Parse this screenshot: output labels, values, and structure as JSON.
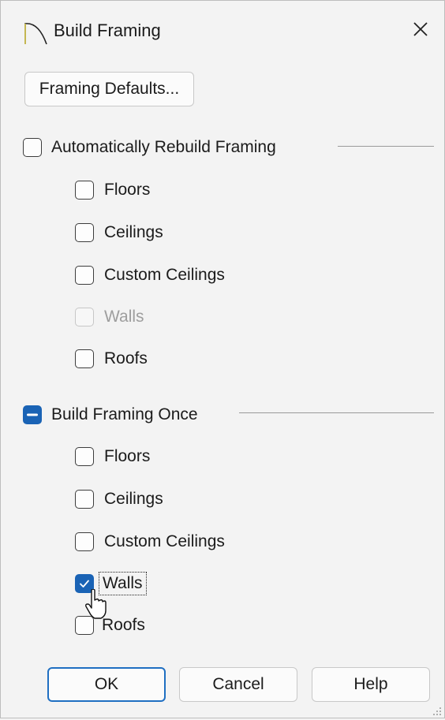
{
  "window": {
    "title": "Build Framing",
    "app_icon": "arc-icon",
    "close_icon": "close-icon"
  },
  "framing_defaults_button": "Framing Defaults...",
  "auto_rebuild": {
    "label": "Automatically Rebuild Framing",
    "state": "unchecked",
    "items": [
      {
        "label": "Floors",
        "state": "unchecked",
        "enabled": true
      },
      {
        "label": "Ceilings",
        "state": "unchecked",
        "enabled": true
      },
      {
        "label": "Custom Ceilings",
        "state": "unchecked",
        "enabled": true
      },
      {
        "label": "Walls",
        "state": "unchecked",
        "enabled": false
      },
      {
        "label": "Roofs",
        "state": "unchecked",
        "enabled": true
      }
    ]
  },
  "build_once": {
    "label": "Build Framing Once",
    "state": "indeterminate",
    "items": [
      {
        "label": "Floors",
        "state": "unchecked",
        "enabled": true
      },
      {
        "label": "Ceilings",
        "state": "unchecked",
        "enabled": true
      },
      {
        "label": "Custom Ceilings",
        "state": "unchecked",
        "enabled": true
      },
      {
        "label": "Walls",
        "state": "checked",
        "enabled": true
      },
      {
        "label": "Roofs",
        "state": "unchecked",
        "enabled": true
      }
    ]
  },
  "buttons": {
    "ok": "OK",
    "cancel": "Cancel",
    "help": "Help"
  },
  "colors": {
    "accent": "#1a63b5",
    "background": "#f3f3f3"
  }
}
